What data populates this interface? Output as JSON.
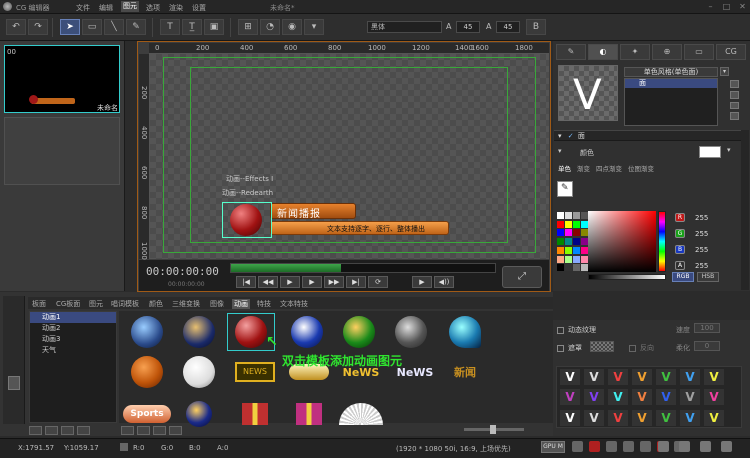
{
  "app": {
    "title": "CG 编辑器",
    "document_title": "未命名*"
  },
  "menu": [
    "文件",
    "编辑",
    "图元",
    "选项",
    "渲染",
    "设置"
  ],
  "menu_active": "图元",
  "toolbar": {
    "font": "黑体",
    "size_a": "45",
    "size_b": "45"
  },
  "thumbnails": [
    {
      "index": "00",
      "label": "未命名"
    }
  ],
  "ruler": {
    "top": [
      "0",
      "200",
      "400",
      "600",
      "800",
      "1000",
      "1200",
      "1400",
      "1600",
      "1800"
    ],
    "left": [
      "200",
      "400",
      "600",
      "800",
      "1000"
    ]
  },
  "stage": {
    "effect_label_1": "动画--Effects I",
    "effect_label_2": "动画--Redearth",
    "news_title": "新闻播报",
    "ticker_text": "文本支持逐字、逐行、整体播出"
  },
  "transport": {
    "timecode": "00:00:00:00",
    "sub_timecode": "00:00:00:00"
  },
  "right_panel": {
    "tabs": [
      "CG"
    ],
    "preview_letter": "V",
    "style_title": "单色风格(单色面)",
    "style_item": "面",
    "section_face": "面",
    "color_label": "颜色",
    "color_tabs": [
      "单色",
      "渐变",
      "四点渐变",
      "位图渐变"
    ],
    "channels": [
      {
        "label": "R",
        "value": "255",
        "color": "#c01818"
      },
      {
        "label": "G",
        "value": "255",
        "color": "#18a018"
      },
      {
        "label": "B",
        "value": "255",
        "color": "#1838c0"
      },
      {
        "label": "A",
        "value": "255",
        "color": "#303030"
      }
    ],
    "mode_buttons": [
      "RGB",
      "HSB"
    ],
    "section_shadow": "阴影",
    "dynamic_texture": "动态纹理",
    "speed_label": "速度",
    "speed_value": "100",
    "mask_label": "遮罩",
    "invert_label": "反向",
    "soften_label": "柔化",
    "soften_value": "0"
  },
  "bottom": {
    "tabs": [
      "板面",
      "CG板面",
      "图元",
      "唱词模板",
      "颜色",
      "三维变换",
      "图像",
      "动画",
      "特技",
      "文本特技"
    ],
    "active_tab": "动画",
    "anim_list": [
      "动画1",
      "动画2",
      "动画3",
      "天气"
    ],
    "gallery_labels": [
      "NEWS",
      "NeWS",
      "NeWS",
      "新闻",
      "Sports"
    ],
    "hint": "双击模板添加动画图元"
  },
  "status": {
    "x": "X:1791.57",
    "y": "Y:1059.17",
    "r": "R:0",
    "g": "G:0",
    "b": "B:0",
    "a": "A:0",
    "format": "(1920 * 1080 50i, 16:9, 上场优先)",
    "mode": "GPU M"
  },
  "colors": {
    "accent_select": "#3a4a80",
    "safe_frame": "#39a83a",
    "hint_green": "#2fe62f",
    "canvas_border": "#a05a16"
  }
}
